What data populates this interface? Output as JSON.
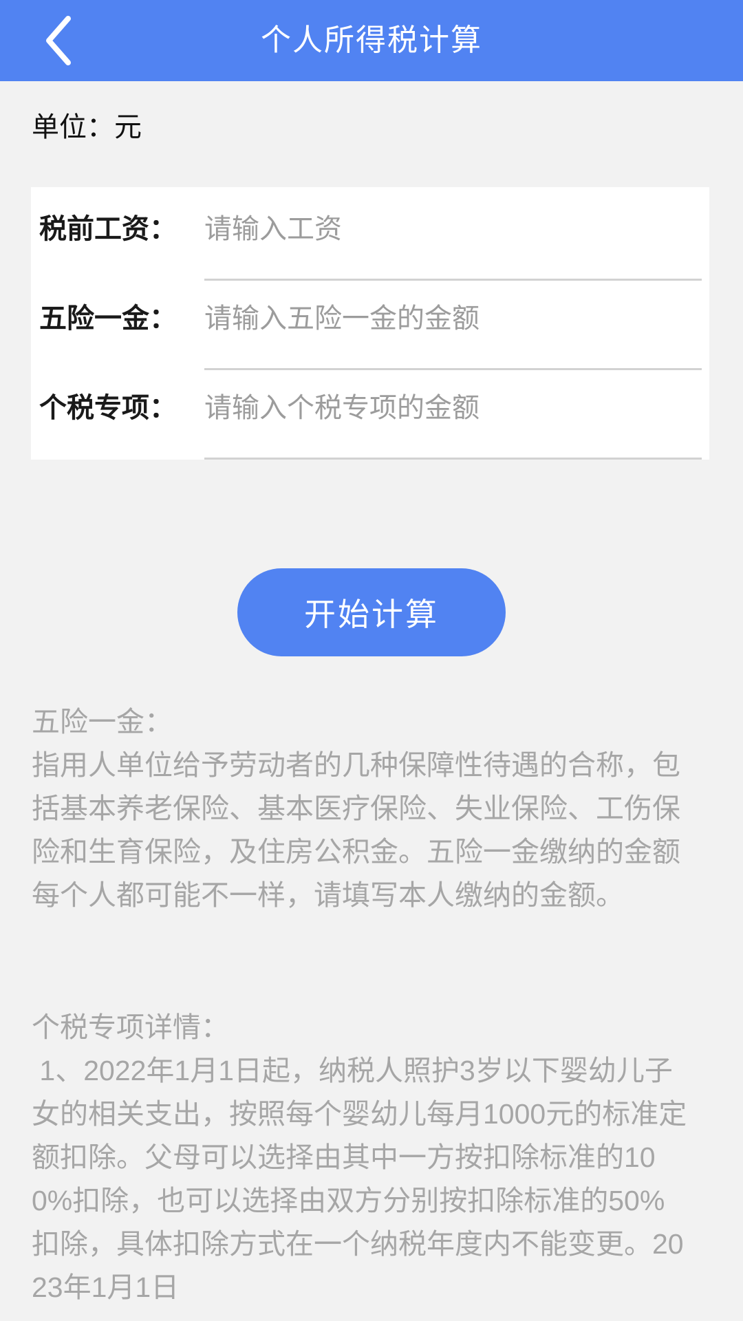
{
  "theme": {
    "accent": "#5183f2",
    "page_bg": "#f2f2f2",
    "card_bg": "#ffffff",
    "label_color": "#1a1a1a",
    "placeholder_color": "#9c9c9c",
    "info_text_color": "#a6a6a6",
    "underline_color": "#d2d2d2"
  },
  "header": {
    "title": "个人所得税计算",
    "back_icon": "chevron-left-icon"
  },
  "unit": {
    "text": "单位：元"
  },
  "form": {
    "rows": [
      {
        "label": "税前工资：",
        "placeholder": "请输入工资",
        "value": ""
      },
      {
        "label": "五险一金：",
        "placeholder": "请输入五险一金的金额",
        "value": ""
      },
      {
        "label": "个税专项：",
        "placeholder": "请输入个税专项的金额",
        "value": ""
      }
    ]
  },
  "actions": {
    "calculate_label": "开始计算"
  },
  "info": {
    "insurance": "五险一金：\n指用人单位给予劳动者的几种保障性待遇的合称，包括基本养老保险、基本医疗保险、失业保险、工伤保险和生育保险，及住房公积金。五险一金缴纳的金额每个人都可能不一样，请填写本人缴纳的金额。",
    "special": "个税专项详情：\n 1、2022年1月1日起，纳税人照护3岁以下婴幼儿子女的相关支出，按照每个婴幼儿每月1000元的标准定额扣除。父母可以选择由其中一方按扣除标准的100%扣除，也可以选择由双方分别按扣除标准的50%扣除，具体扣除方式在一个纳税年度内不能变更。2023年1月1日"
  }
}
